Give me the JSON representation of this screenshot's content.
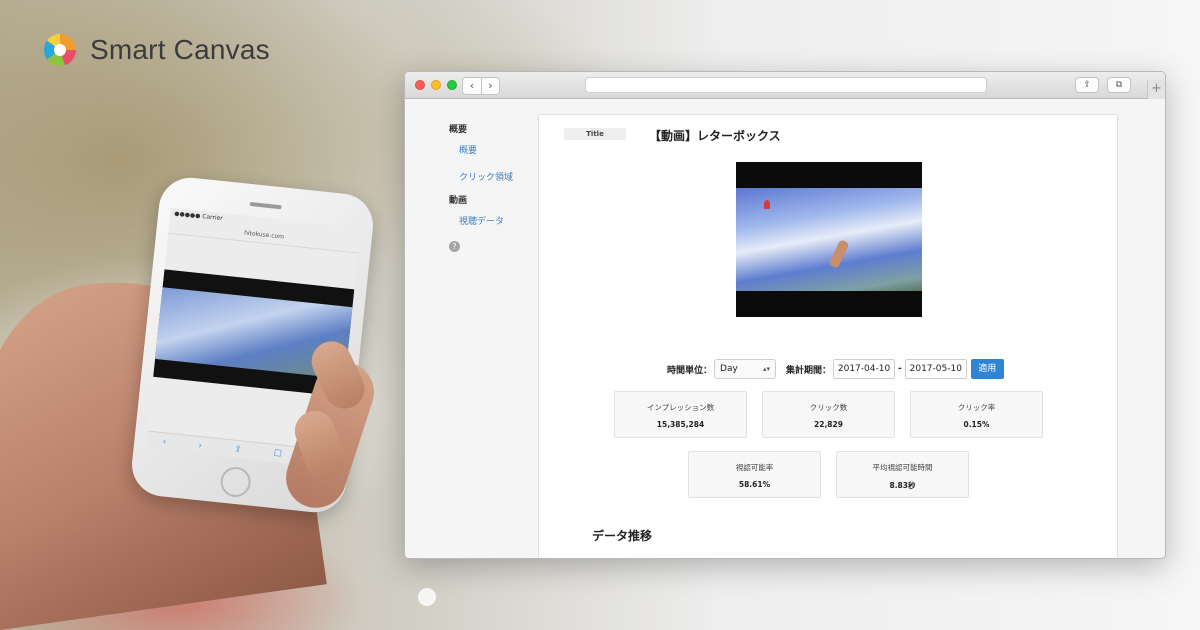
{
  "brand": {
    "name": "Smart Canvas"
  },
  "phone": {
    "carrier": "●●●●● Carrier",
    "url": "hitokuse.com"
  },
  "browser": {
    "nav": {
      "back": "‹",
      "forward": "›"
    },
    "share_icon": "share-icon",
    "tabs_icon": "tabs-icon",
    "new_tab": "+"
  },
  "sidebar": {
    "sections": [
      {
        "label": "概要",
        "items": [
          "概要",
          "クリック領域"
        ]
      },
      {
        "label": "動画",
        "items": [
          "視聴データ"
        ]
      }
    ],
    "help": "?"
  },
  "panel": {
    "title_tag": "Title",
    "title": "【動画】レターボックス",
    "controls": {
      "time_unit_label": "時間単位：",
      "time_unit_value": "Day",
      "period_label": "集計期間：",
      "date_from": "2017-04-10",
      "date_separator": "-",
      "date_to": "2017-05-10",
      "apply_label": "適用"
    },
    "stats": [
      {
        "label": "インプレッション数",
        "value": "15,385,284"
      },
      {
        "label": "クリック数",
        "value": "22,829"
      },
      {
        "label": "クリック率",
        "value": "0.15%"
      },
      {
        "label": "視認可能率",
        "value": "58.61%"
      },
      {
        "label": "平均視認可能時間",
        "value": "8.83秒"
      }
    ],
    "section_title": "データ推移"
  }
}
